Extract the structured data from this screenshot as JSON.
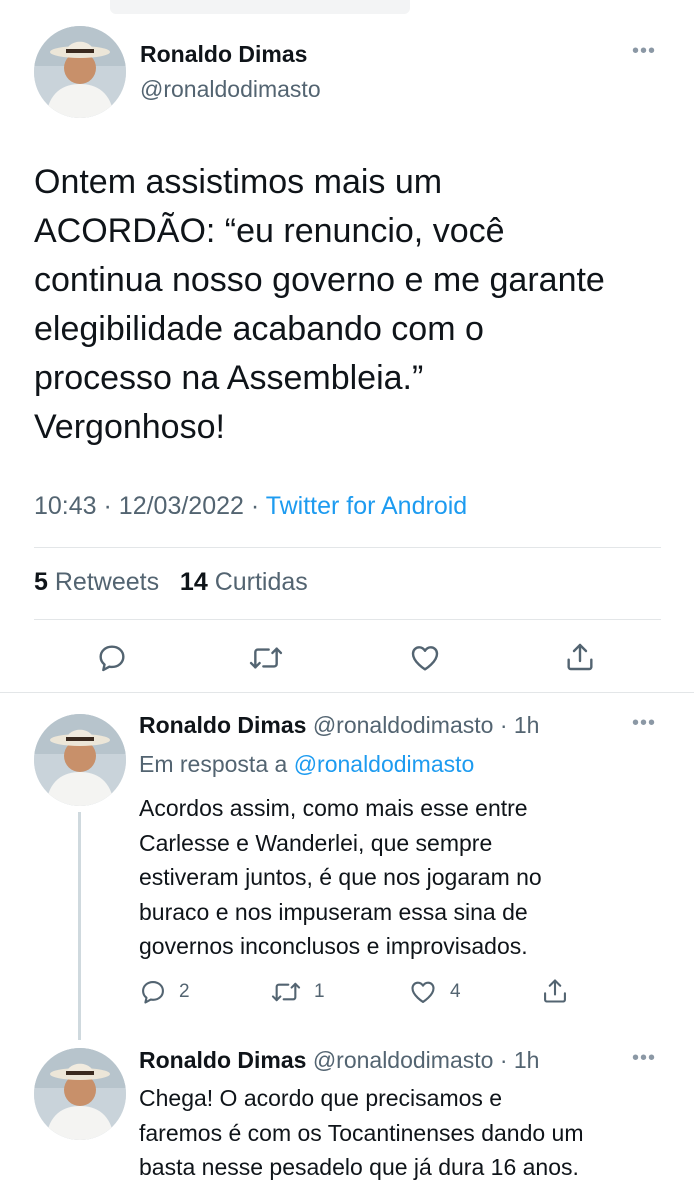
{
  "main_tweet": {
    "author_name": "Ronaldo Dimas",
    "author_handle": "@ronaldodimasto",
    "more_icon": "more-horizontal-icon",
    "text_lines": [
      "Ontem assistimos mais um",
      "ACORDÃO: “eu renuncio, você",
      "continua nosso governo e me garante",
      "elegibilidade acabando com o",
      "processo na Assembleia.”",
      "Vergonhoso!"
    ],
    "time": "10:43",
    "date": "12/03/2022",
    "separator": "·",
    "source": "Twitter for Android",
    "retweets_count": "5",
    "retweets_label": "Retweets",
    "likes_count": "14",
    "likes_label": "Curtidas",
    "actions": [
      "reply-icon",
      "retweet-icon",
      "like-icon",
      "share-icon"
    ]
  },
  "replies": [
    {
      "author_name": "Ronaldo Dimas",
      "author_handle": "@ronaldodimasto",
      "time": "· 1h",
      "in_reply_prefix": "Em resposta a",
      "in_reply_handle": "@ronaldodimasto",
      "text_lines": [
        "Acordos assim, como mais esse entre",
        "Carlesse e Wanderlei, que sempre",
        "estiveram juntos, é que nos jogaram no",
        "buraco e nos impuseram essa sina de",
        "governos inconclusos e improvisados."
      ],
      "reply_count": "2",
      "retweet_count": "1",
      "like_count": "4"
    },
    {
      "author_name": "Ronaldo Dimas",
      "author_handle": "@ronaldodimasto",
      "time": "· 1h",
      "text_lines": [
        "Chega! O acordo que precisamos e",
        "faremos é com os Tocantinenses dando um",
        "basta nesse pesadelo que já dura 16 anos."
      ]
    }
  ],
  "colors": {
    "link": "#1d9bf0",
    "secondary_text": "#536471",
    "primary_text": "#0f1419",
    "divider": "#e3e6e8"
  }
}
